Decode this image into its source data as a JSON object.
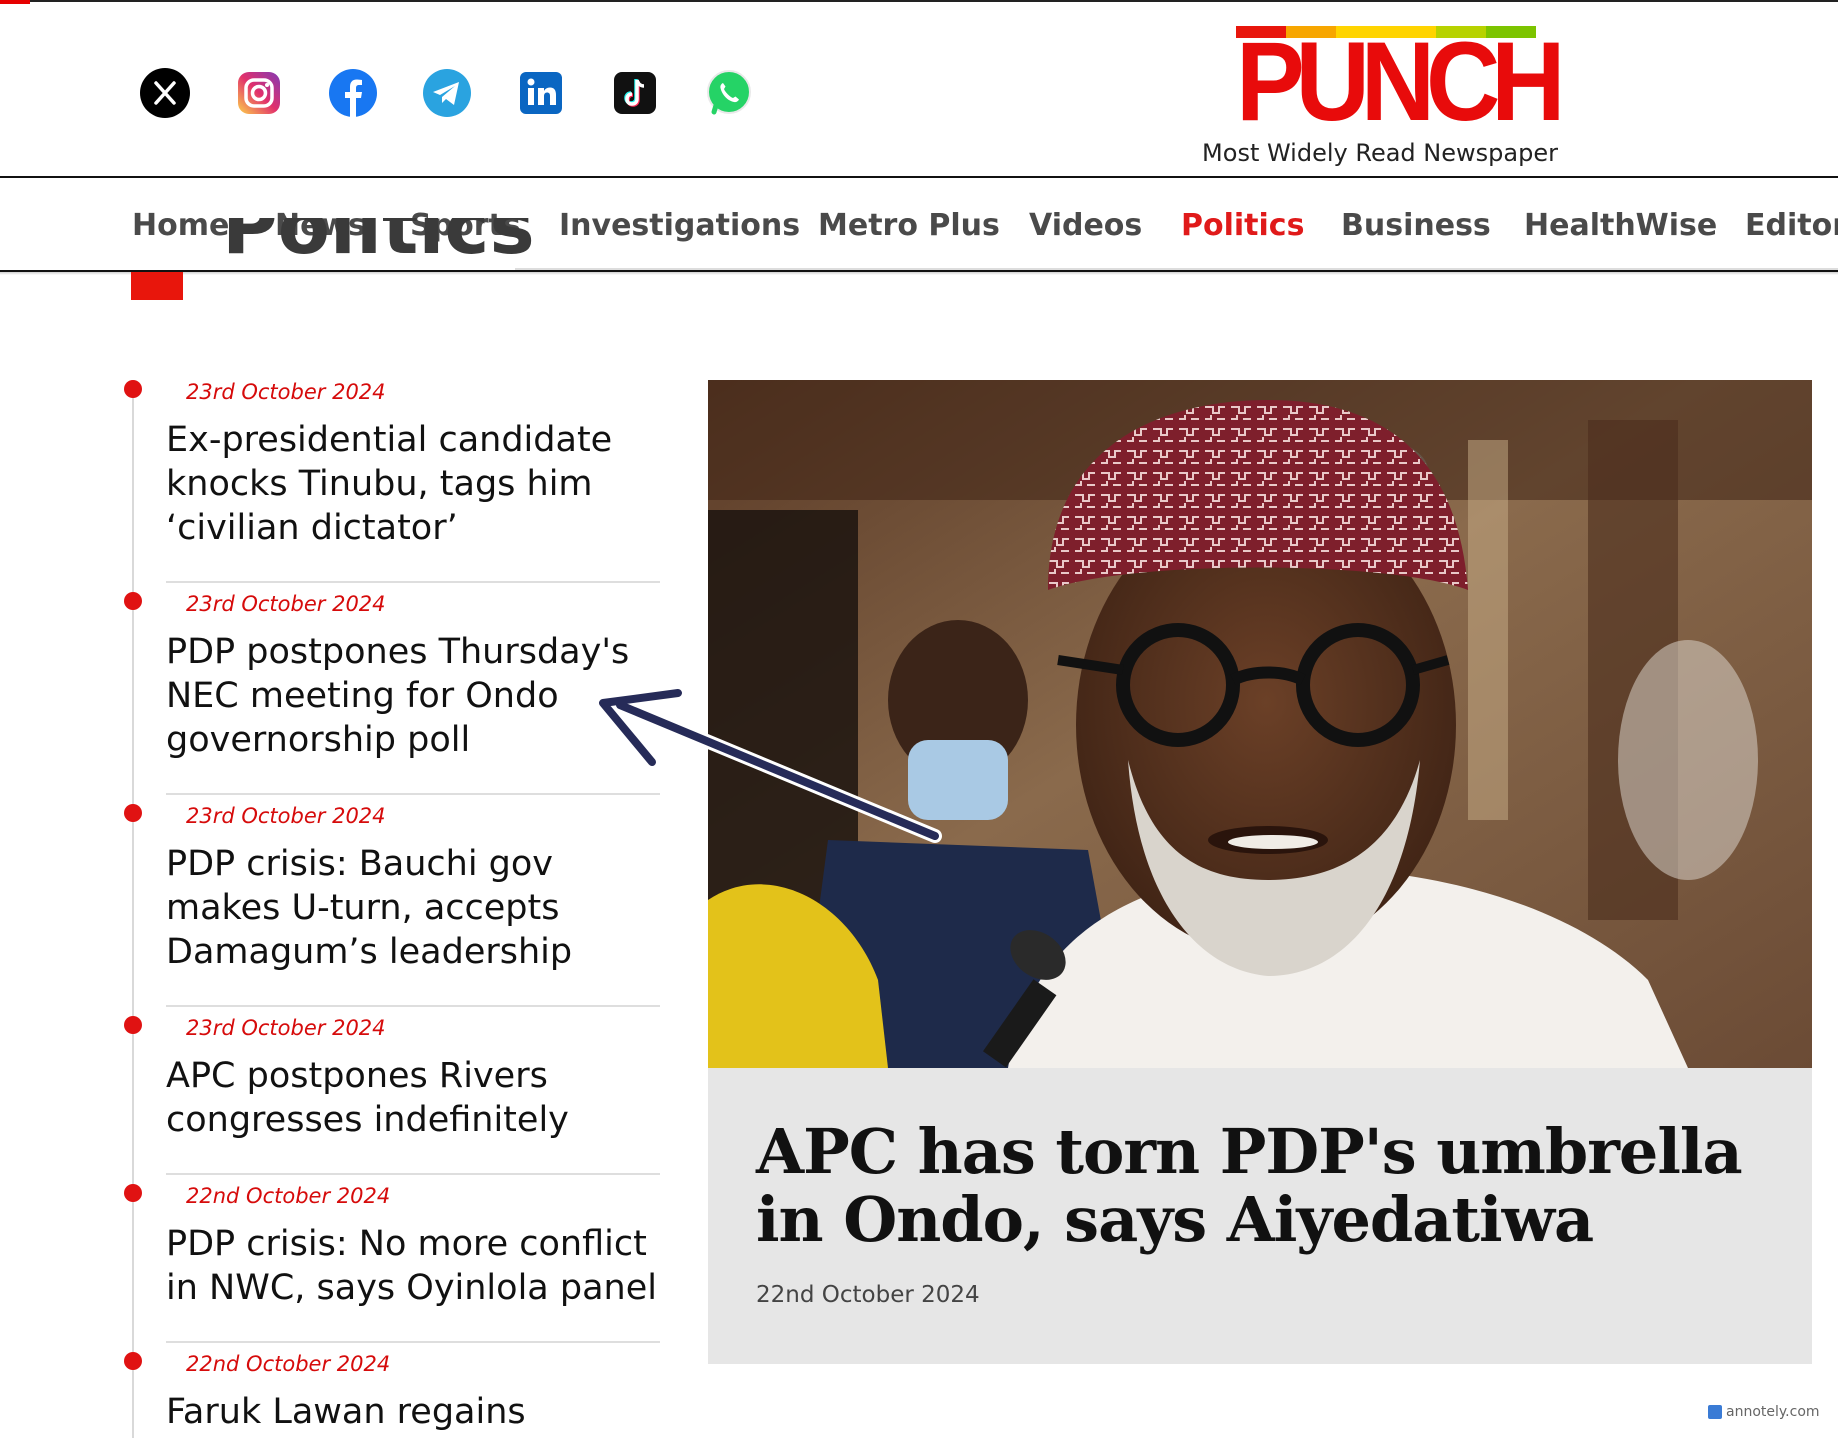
{
  "social": {
    "items": [
      {
        "name": "x-icon",
        "glyph": "𝕏",
        "color": "#000000"
      },
      {
        "name": "instagram-icon",
        "glyph": "◎",
        "color": "#d6249f"
      },
      {
        "name": "facebook-icon",
        "glyph": "f",
        "color": "#1877f2"
      },
      {
        "name": "telegram-icon",
        "glyph": "➤",
        "color": "#2aa3e0"
      },
      {
        "name": "linkedin-icon",
        "glyph": "in",
        "color": "#0a66c2"
      },
      {
        "name": "tiktok-icon",
        "glyph": "♪",
        "color": "#111111"
      },
      {
        "name": "whatsapp-icon",
        "glyph": "✆",
        "color": "#25d366"
      }
    ]
  },
  "brand": {
    "logo_text": "PUNCH",
    "tagline": "Most Widely Read Newspaper",
    "logo_color": "#e80b0b",
    "bar_colors": [
      "#e8160c",
      "#f7a600",
      "#ffd400",
      "#ffd400",
      "#b7d200",
      "#7cc400"
    ]
  },
  "nav": {
    "items": [
      "Home",
      "News",
      "Sports",
      "Investigations",
      "Metro Plus",
      "Videos",
      "Politics",
      "Business",
      "HealthWise",
      "Editori"
    ],
    "active": "Politics",
    "active_color": "#e01a1a"
  },
  "section": {
    "title": "Politics"
  },
  "news": [
    {
      "date": "23rd October 2024",
      "headline": "Ex-presidential candidate knocks Tinubu, tags him ‘civilian dictator’"
    },
    {
      "date": "23rd October 2024",
      "headline": "PDP postpones Thursday's NEC meeting for Ondo governorship poll"
    },
    {
      "date": "23rd October 2024",
      "headline": "PDP crisis: Bauchi gov makes U-turn, accepts Damagum’s leadership"
    },
    {
      "date": "23rd October 2024",
      "headline": "APC postpones Rivers congresses indefinitely"
    },
    {
      "date": "22nd October 2024",
      "headline": "PDP crisis: No more conflict in NWC, says Oyinlola panel"
    },
    {
      "date": "22nd October 2024",
      "headline": "Faruk Lawan regains"
    }
  ],
  "feature": {
    "title": "APC has torn PDP's umbrella in Ondo, says Aiyedatiwa",
    "date": "22nd October 2024"
  },
  "watermark": {
    "text": "annotely.com"
  }
}
